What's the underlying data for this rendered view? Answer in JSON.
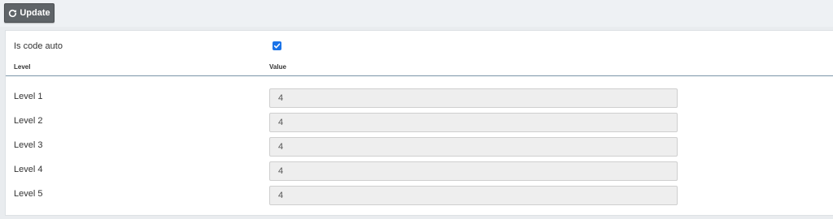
{
  "toolbar": {
    "update_label": "Update",
    "update_icon": "refresh-icon"
  },
  "form": {
    "is_code_auto_label": "Is code auto",
    "is_code_auto_checked": true,
    "checkbox_color": "#1a73e8",
    "header_level": "Level",
    "header_value": "Value",
    "levels": [
      {
        "label": "Level 1",
        "value": "4"
      },
      {
        "label": "Level 2",
        "value": "4"
      },
      {
        "label": "Level 3",
        "value": "4"
      },
      {
        "label": "Level 4",
        "value": "4"
      },
      {
        "label": "Level 5",
        "value": "4"
      }
    ]
  }
}
